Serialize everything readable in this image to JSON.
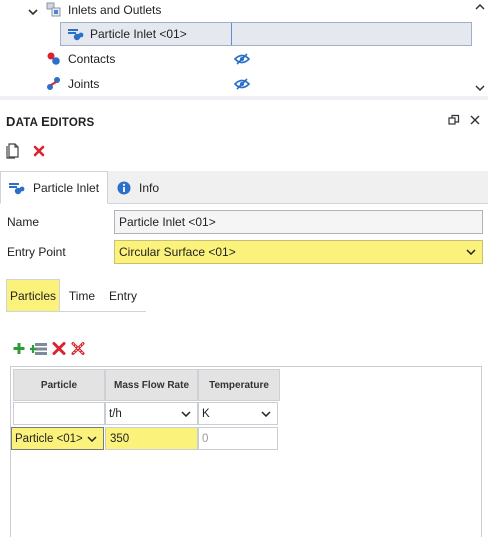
{
  "tree": {
    "items": [
      {
        "label": "Inlets and Outlets",
        "icon": "inlets-outlets-icon",
        "expanded": true
      },
      {
        "label": "Particle Inlet <01>",
        "icon": "particle-inlet-icon",
        "selected": true
      },
      {
        "label": "Contacts",
        "icon": "contacts-icon",
        "visibility_icon": "eye-hidden-icon"
      },
      {
        "label": "Joints",
        "icon": "joints-icon",
        "visibility_icon": "eye-hidden-icon"
      }
    ]
  },
  "data_editors": {
    "title_first": "D",
    "title_rest": "ATA ",
    "title_second": "E",
    "title_second_rest": "DITORS"
  },
  "main_tabs": [
    {
      "label": "Particle Inlet",
      "icon": "particle-inlet-icon",
      "active": true
    },
    {
      "label": "Info",
      "icon": "info-icon",
      "active": false
    }
  ],
  "form": {
    "name_label": "Name",
    "name_value": "Particle Inlet <01>",
    "entry_point_label": "Entry Point",
    "entry_point_value": "Circular Surface <01>"
  },
  "sub_tabs": [
    {
      "label": "Particles",
      "active": true
    },
    {
      "label": "Time",
      "active": false
    },
    {
      "label": "Entry",
      "active": false
    }
  ],
  "grid": {
    "headers": [
      "Particle",
      "Mass Flow Rate",
      "Temperature"
    ],
    "units": [
      "t/h",
      "K"
    ],
    "rows": [
      {
        "particle": "Particle <01>",
        "mass_flow_rate": "350",
        "temperature": "0"
      }
    ]
  },
  "colors": {
    "highlight_yellow": "#fbf27b",
    "accent_blue": "#2a6fc9",
    "delete_red": "#d9232e",
    "add_green": "#2e9b3a"
  }
}
